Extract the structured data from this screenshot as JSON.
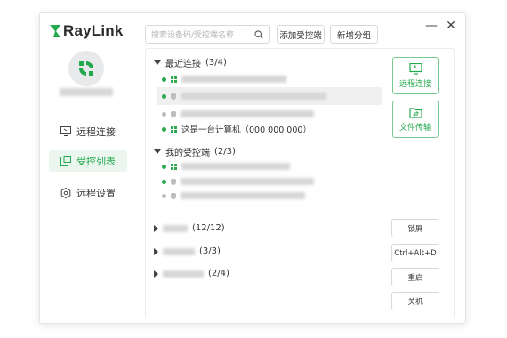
{
  "app": {
    "logo_text": "RayLink",
    "brand_color": "#23a94d"
  },
  "window_controls": {
    "minimize_label": "—",
    "close_label": "✕"
  },
  "sidebar": {
    "items": [
      {
        "label": "远程连接",
        "icon": "monitor-icon",
        "active": false
      },
      {
        "label": "受控列表",
        "icon": "device-list-icon",
        "active": true
      },
      {
        "label": "远程设置",
        "icon": "gear-icon",
        "active": false
      }
    ]
  },
  "toolbar": {
    "search_placeholder": "搜索设备码/受控端名称",
    "add_controlled_label": "添加受控端",
    "new_group_label": "新增分组"
  },
  "groups": [
    {
      "name": "最近连接",
      "count": "(3/4)",
      "expanded": true
    },
    {
      "name": "我的受控端",
      "count": "(2/3)",
      "expanded": true
    },
    {
      "name": "",
      "count": "(12/12)",
      "expanded": false
    },
    {
      "name": "",
      "count": "(3/3)",
      "expanded": false
    },
    {
      "name": "",
      "count": "(2/4)",
      "expanded": false
    }
  ],
  "devices": {
    "this_computer": "这是一台计算机（000 000 000）"
  },
  "actions": {
    "remote_connect_label": "远程连接",
    "file_transfer_label": "文件传输",
    "lock_label": "锁屏",
    "cad_label": "Ctrl+Alt+D",
    "restart_label": "重启",
    "shutdown_label": "关机"
  },
  "status_colors": {
    "online": "#2ca84f",
    "offline": "#bdbdbd"
  }
}
